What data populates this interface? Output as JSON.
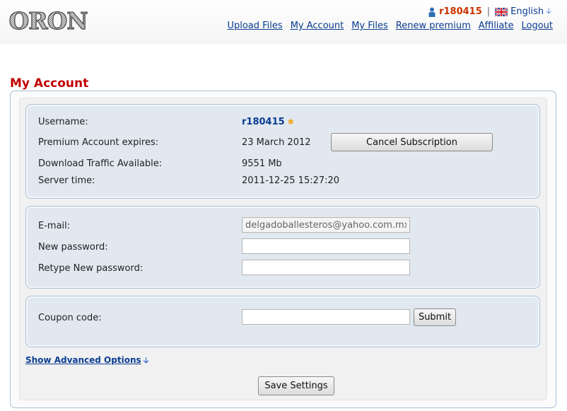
{
  "header": {
    "logo_text": "ORON",
    "username": "r180415",
    "separator": "|",
    "language": "English",
    "nav": [
      {
        "label": "Upload Files"
      },
      {
        "label": "My Account"
      },
      {
        "label": "My Files"
      },
      {
        "label": "Renew premium"
      },
      {
        "label": "Affiliate"
      },
      {
        "label": "Logout"
      }
    ]
  },
  "page": {
    "title": "My Account"
  },
  "account": {
    "username_label": "Username:",
    "username_value": "r180415",
    "premium_label": "Premium Account expires:",
    "premium_value": "23 March 2012",
    "cancel_button": "Cancel Subscription",
    "traffic_label": "Download Traffic Available:",
    "traffic_value": "9551 Mb",
    "server_time_label": "Server time:",
    "server_time_value": "2011-12-25 15:27:20"
  },
  "credentials": {
    "email_label": "E-mail:",
    "email_value": "delgadoballesteros@yahoo.com.mx",
    "new_password_label": "New password:",
    "new_password_value": "",
    "retype_password_label": "Retype New password:",
    "retype_password_value": ""
  },
  "coupon": {
    "label": "Coupon code:",
    "value": "",
    "submit_button": "Submit"
  },
  "advanced": {
    "link": "Show Advanced Options"
  },
  "save_button": "Save Settings",
  "colors": {
    "title_red": "#c00000",
    "link_blue": "#0b3d91",
    "username_orange": "#cc3300",
    "panel_bg": "#e1e8ef",
    "panel_border": "#a6c3dc"
  }
}
